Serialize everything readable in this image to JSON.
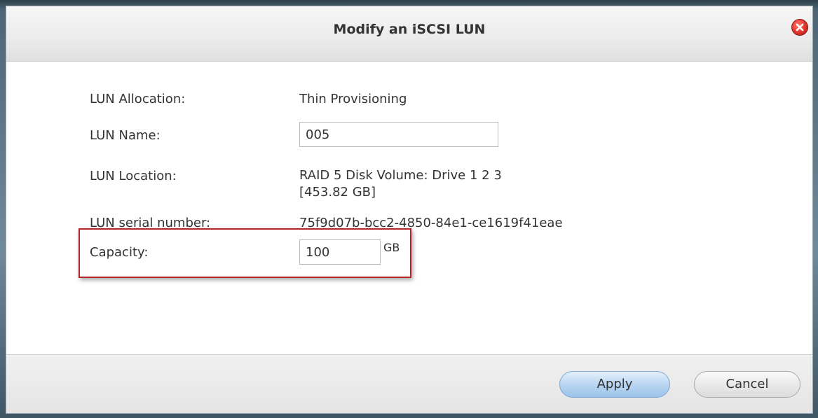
{
  "dialog": {
    "title": "Modify an iSCSI LUN"
  },
  "fields": {
    "allocation": {
      "label": "LUN Allocation:",
      "value": "Thin Provisioning"
    },
    "name": {
      "label": "LUN Name:",
      "value": "005"
    },
    "location": {
      "label": "LUN Location:",
      "value_line1": "RAID 5 Disk Volume: Drive 1 2 3",
      "value_line2": "[453.82 GB]"
    },
    "serial": {
      "label": "LUN serial number:",
      "value": "75f9d07b-bcc2-4850-84e1-ce1619f41eae"
    },
    "capacity": {
      "label": "Capacity:",
      "value": "100",
      "unit": "GB"
    }
  },
  "buttons": {
    "apply": "Apply",
    "cancel": "Cancel"
  },
  "colors": {
    "highlight": "#b2262a",
    "close": "#e0332a",
    "apply": "#b9d6f1"
  }
}
